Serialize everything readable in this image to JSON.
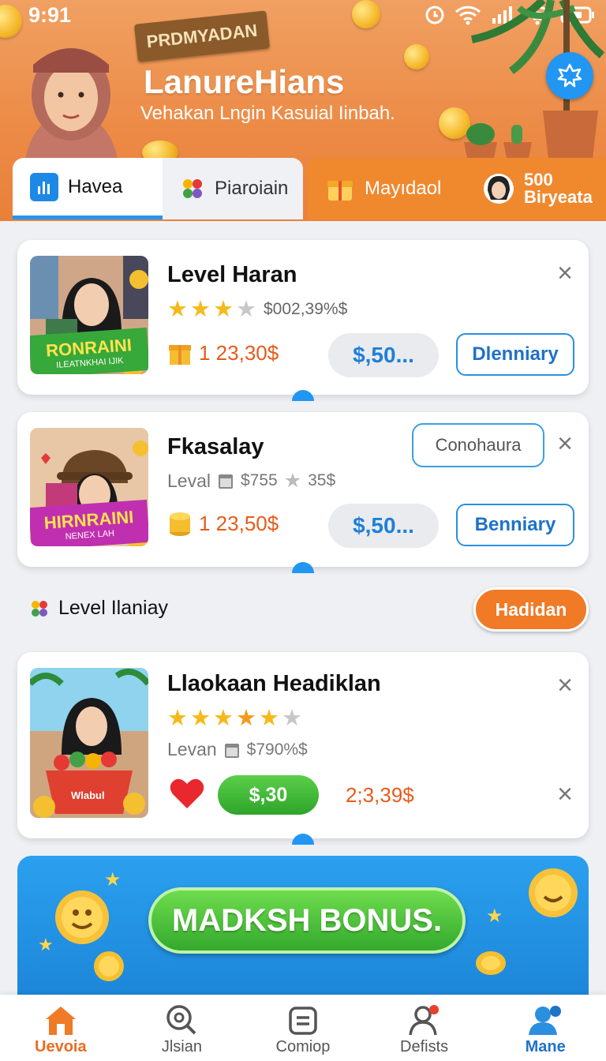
{
  "status_bar": {
    "time": "9:91"
  },
  "header": {
    "ribbon": "PRDMYADAN",
    "title": "LanureHians",
    "subtitle": "Vehakan Lngin Kasuial Iinbah."
  },
  "tabs": [
    {
      "label": "Havea",
      "icon": "bar-chart-icon"
    },
    {
      "label": "Piaroiain",
      "icon": "apps-icon"
    },
    {
      "label": "Mayıdaol",
      "icon": "gift-icon"
    },
    {
      "label_line1": "500",
      "label_line2": "Biryeata",
      "icon": "avatar"
    }
  ],
  "cards": [
    {
      "title": "Level Haran",
      "rating_text": "$002,39%$",
      "price": "1 23,30$",
      "price_pill": "$,50...",
      "action": "Dlenniary",
      "thumb_title": "RONRAINI",
      "thumb_sub": "ILEATNKHAI IJIK"
    },
    {
      "title": "Fkasalay",
      "chip": "Conohaura",
      "sub_label": "Leval",
      "sub_value": "$755",
      "sub_value2": "35$",
      "price": "1 23,50$",
      "price_pill": "$,50...",
      "action": "Benniary",
      "thumb_title": "HIRNRAINI",
      "thumb_sub": "NENEX LAH"
    },
    {
      "title": "Llaokaan Headiklan",
      "sub_label": "Levan",
      "sub_value": "$790%$",
      "green_button": "$,30",
      "price": "2;3,39$",
      "thumb_basket": "Wlabul"
    }
  ],
  "section": {
    "label": "Level Ilaniay",
    "button": "Hadidan"
  },
  "banner": {
    "button": "MADKSH BONUS."
  },
  "bottom_nav": [
    {
      "label": "Uevoia",
      "icon": "home-icon"
    },
    {
      "label": "Jlsian",
      "icon": "search-icon"
    },
    {
      "label": "Comiop",
      "icon": "document-icon"
    },
    {
      "label": "Defists",
      "icon": "user-badge-icon"
    },
    {
      "label": "Mane",
      "icon": "profile-icon"
    }
  ],
  "colors": {
    "brand_orange": "#ec8a45",
    "accent_blue": "#2196f3",
    "price_red": "#e85b1a",
    "green": "#33a92c"
  }
}
